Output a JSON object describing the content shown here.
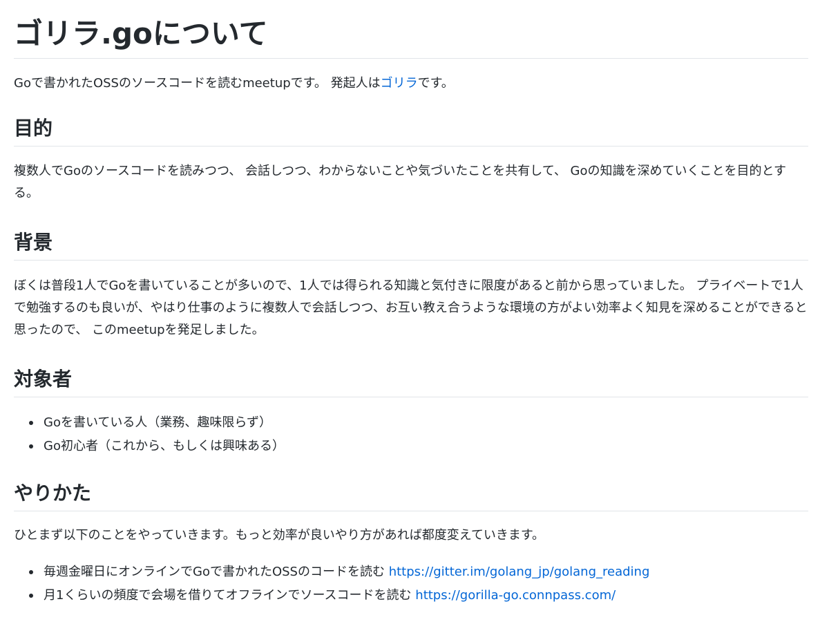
{
  "title": "ゴリラ.goについて",
  "intro": {
    "before": "Goで書かれたOSSのソースコードを読むmeetupです。 発起人は",
    "link": "ゴリラ",
    "after": "です。"
  },
  "purpose": {
    "heading": "目的",
    "text": "複数人でGoのソースコードを読みつつ、 会話しつつ、わからないことや気づいたことを共有して、 Goの知識を深めていくことを目的とする。"
  },
  "background": {
    "heading": "背景",
    "text": "ぼくは普段1人でGoを書いていることが多いので、1人では得られる知識と気付きに限度があると前から思っていました。 プライベートで1人で勉強するのも良いが、やはり仕事のように複数人で会話しつつ、お互い教え合うような環境の方がよい効率よく知見を深めることができると思ったので、 このmeetupを発足しました。"
  },
  "audience": {
    "heading": "対象者",
    "items": [
      "Goを書いている人（業務、趣味限らず）",
      "Go初心者（これから、もしくは興味ある）"
    ]
  },
  "method": {
    "heading": "やりかた",
    "text": "ひとまず以下のことをやっていきます。もっと効率が良いやり方があれば都度変えていきます。",
    "items": [
      {
        "text": "毎週金曜日にオンラインでGoで書かれたOSSのコードを読む ",
        "link": "https://gitter.im/golang_jp/golang_reading"
      },
      {
        "text": "月1くらいの頻度で会場を借りてオフラインでソースコードを読む ",
        "link": "https://gorilla-go.connpass.com/"
      }
    ]
  },
  "colors": {
    "text": "#24292e",
    "link": "#0366d6",
    "divider": "#e1e4e8"
  }
}
